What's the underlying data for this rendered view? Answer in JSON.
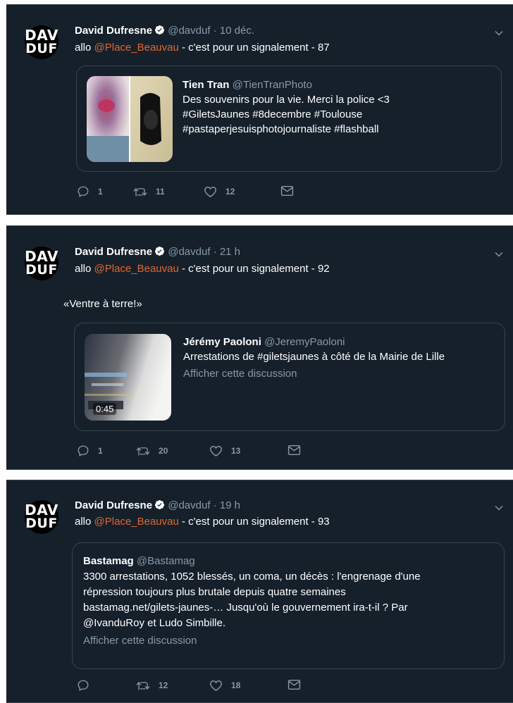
{
  "tweets": [
    {
      "author": "David Dufresne",
      "handle": "@davduf",
      "time": "10 déc.",
      "text_prefix": "allo ",
      "mention": "@Place_Beauvau",
      "text_suffix": " - c'est pour un signalement - 87",
      "comment": "",
      "quote": {
        "author": "Tien Tran",
        "handle": "@TienTranPhoto",
        "lines": [
          "Des souvenirs pour la vie. Merci la police <3",
          "#GiletsJaunes #8decembre #Toulouse",
          "#pastaperjesuisphotojournaliste #flashball"
        ],
        "show_thread": "",
        "duration": ""
      },
      "replies": "1",
      "retweets": "11",
      "likes": "12"
    },
    {
      "author": "David Dufresne",
      "handle": "@davduf",
      "time": "21 h",
      "text_prefix": "allo ",
      "mention": "@Place_Beauvau",
      "text_suffix": " - c'est pour un signalement - 92",
      "comment": "«Ventre à terre!»",
      "quote": {
        "author": "Jérémy Paoloni",
        "handle": "@JeremyPaoloni",
        "lines": [
          "Arrestations de #giletsjaunes à côté de la Mairie de Lille"
        ],
        "show_thread": "Afficher cette discussion",
        "duration": "0:45"
      },
      "replies": "1",
      "retweets": "20",
      "likes": "13"
    },
    {
      "author": "David Dufresne",
      "handle": "@davduf",
      "time": "19 h",
      "text_prefix": "allo ",
      "mention": "@Place_Beauvau",
      "text_suffix": " - c'est pour un signalement - 93",
      "comment": "",
      "quote": {
        "author": "Bastamag",
        "handle": "@Bastamag",
        "lines": [
          "3300 arrestations, 1052 blessés, un coma, un décès : l'engrenage d'une",
          "répression toujours plus brutale depuis quatre semaines",
          "bastamag.net/gilets-jaunes-… Jusqu'où le gouvernement ira-t-il ? Par",
          "@IvanduRoy et Ludo Simbille."
        ],
        "show_thread": "Afficher cette discussion",
        "duration": ""
      },
      "replies": "",
      "retweets": "12",
      "likes": "18"
    }
  ],
  "avatar": {
    "line1": "DAV",
    "line2": "DUF"
  },
  "separator": " · ",
  "colors": {
    "background": "#15202b",
    "border": "#38444d",
    "mention": "#e0662e",
    "muted": "#8899a6",
    "verified": "#ffffff"
  },
  "icons": [
    "verified-icon",
    "chevron-down-icon",
    "reply-icon",
    "retweet-icon",
    "like-icon",
    "direct-message-icon"
  ]
}
